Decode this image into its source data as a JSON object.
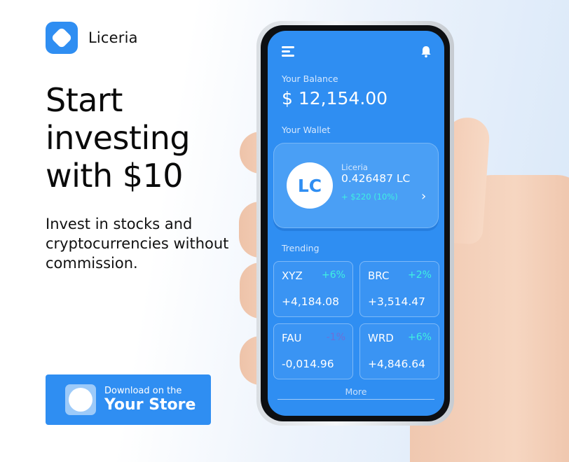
{
  "brand": {
    "name": "Liceria",
    "accent_color": "#2f8ef2"
  },
  "hero": {
    "headline": "Start investing with $10",
    "subline": "Invest in stocks and cryptocurrencies without commission."
  },
  "store_button": {
    "small_text": "Download on the",
    "big_text": "Your Store"
  },
  "app": {
    "balance_label": "Your Balance",
    "balance_value": "$ 12,154.00",
    "wallet_label": "Your Wallet",
    "wallet": {
      "coin_symbol": "LC",
      "name": "Liceria",
      "amount": "0.426487 LC",
      "change": "+ $220 (10%)"
    },
    "trending_label": "Trending",
    "trending": [
      {
        "symbol": "XYZ",
        "percent": "+6%",
        "value": "+4,184.08"
      },
      {
        "symbol": "BRC",
        "percent": "+2%",
        "value": "+3,514.47"
      },
      {
        "symbol": "FAU",
        "percent": "-1%",
        "value": "-0,014.96"
      },
      {
        "symbol": "WRD",
        "percent": "+6%",
        "value": "+4,846.64"
      }
    ],
    "more_label": "More",
    "icons": [
      "menu-icon",
      "bell-icon",
      "chevron-right-icon"
    ]
  }
}
